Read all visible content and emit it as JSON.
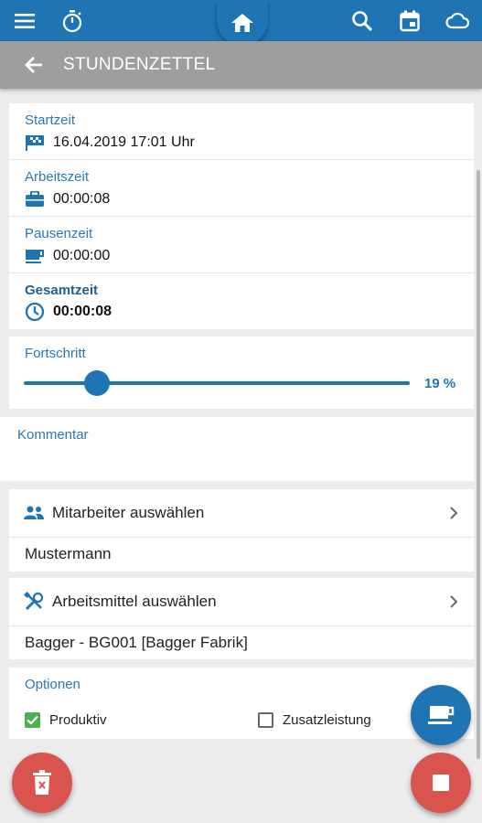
{
  "header": {
    "title": "STUNDENZETTEL"
  },
  "times": {
    "start_label": "Startzeit",
    "start_value": "16.04.2019 17:01 Uhr",
    "work_label": "Arbeitszeit",
    "work_value": "00:00:08",
    "pause_label": "Pausenzeit",
    "pause_value": "00:00:00",
    "total_label": "Gesamtzeit",
    "total_value": "00:00:08"
  },
  "progress": {
    "label": "Fortschritt",
    "value_text": "19 %",
    "value": 0.19
  },
  "comment": {
    "label": "Kommentar",
    "value": ""
  },
  "employee": {
    "select_label": "Mitarbeiter auswählen",
    "value": "Mustermann"
  },
  "equipment": {
    "select_label": "Arbeitsmittel auswählen",
    "value": "Bagger - BG001 [Bagger Fabrik]"
  },
  "options": {
    "label": "Optionen",
    "items": [
      {
        "label": "Produktiv",
        "checked": true
      },
      {
        "label": "Zusatzleistung",
        "checked": false
      }
    ]
  },
  "colors": {
    "primary": "#1f74b4",
    "subheader": "#9e9e9e",
    "danger": "#d9534f",
    "checked": "#4caf50"
  },
  "icons": [
    "menu-icon",
    "stopwatch-icon",
    "home-icon",
    "search-icon",
    "calendar-icon",
    "cloud-icon",
    "back-arrow-icon",
    "flag-icon",
    "briefcase-icon",
    "coffee-icon",
    "clock-icon",
    "people-icon",
    "tools-icon",
    "chevron-right-icon",
    "trash-icon",
    "stop-icon"
  ]
}
